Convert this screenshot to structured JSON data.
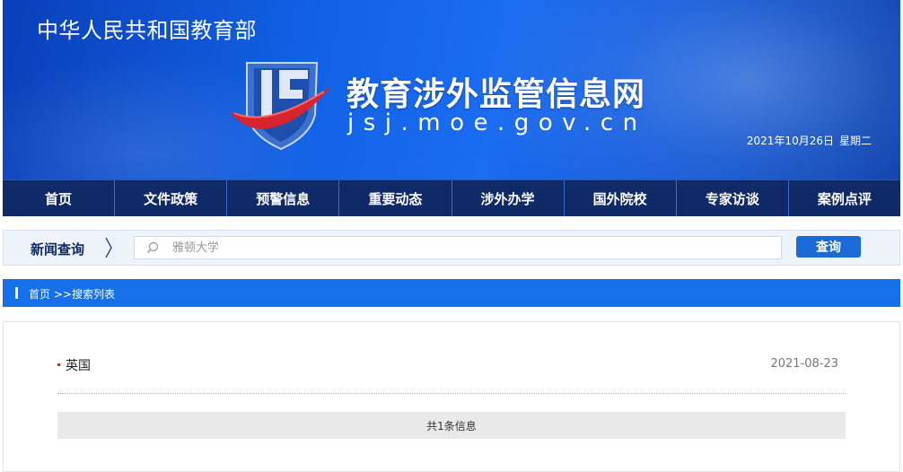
{
  "header": {
    "ministry": "中华人民共和国教育部",
    "site_title": "教育涉外监管信息网",
    "site_domain": "jsj.moe.gov.cn",
    "date": "2021年10月26日",
    "weekday": "星期二"
  },
  "nav": {
    "items": [
      {
        "label": "首页"
      },
      {
        "label": "文件政策"
      },
      {
        "label": "预警信息"
      },
      {
        "label": "重要动态"
      },
      {
        "label": "涉外办学"
      },
      {
        "label": "国外院校"
      },
      {
        "label": "专家访谈"
      },
      {
        "label": "案例点评"
      }
    ]
  },
  "search": {
    "label": "新闻查询",
    "placeholder": "雅顿大学",
    "button_label": "查询"
  },
  "breadcrumb": {
    "home": "首页",
    "current": ">>搜索列表"
  },
  "results": {
    "items": [
      {
        "title": "英国",
        "date": "2021-08-23"
      }
    ],
    "count_text": "共1条信息"
  },
  "colors": {
    "banner": "#1262e6",
    "nav_bg": "#0f2a66",
    "accent": "#1670ea",
    "bullet": "#c0392b"
  }
}
